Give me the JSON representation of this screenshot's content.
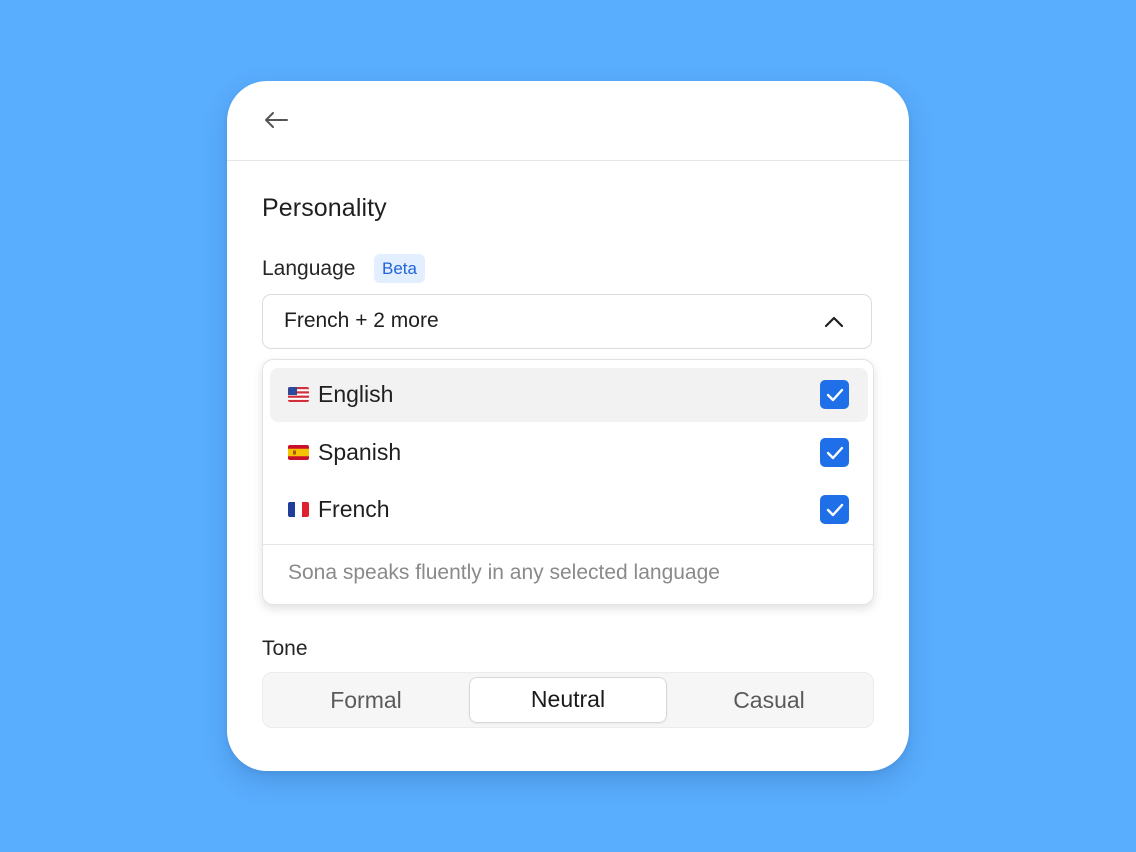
{
  "back_icon": "arrow-left-icon",
  "section_title": "Personality",
  "language": {
    "label": "Language",
    "badge": "Beta",
    "selected_summary": "French + 2 more",
    "chevron_icon": "chevron-up-icon",
    "options": [
      {
        "flag": "🇺🇸",
        "flag_icon": "us-flag-icon",
        "label": "English",
        "checked": true
      },
      {
        "flag": "🇪🇸",
        "flag_icon": "spain-flag-icon",
        "label": "Spanish",
        "checked": true
      },
      {
        "flag": "🇫🇷",
        "flag_icon": "france-flag-icon",
        "label": "French",
        "checked": true
      }
    ],
    "footer_note": "Sona speaks fluently in any selected language"
  },
  "tone": {
    "label": "Tone",
    "options": [
      "Formal",
      "Neutral",
      "Casual"
    ],
    "selected": "Neutral"
  },
  "colors": {
    "background": "#5aaefe",
    "accent": "#1f6fe8",
    "badge_bg": "#e3eefe",
    "badge_text": "#1f64d8"
  }
}
